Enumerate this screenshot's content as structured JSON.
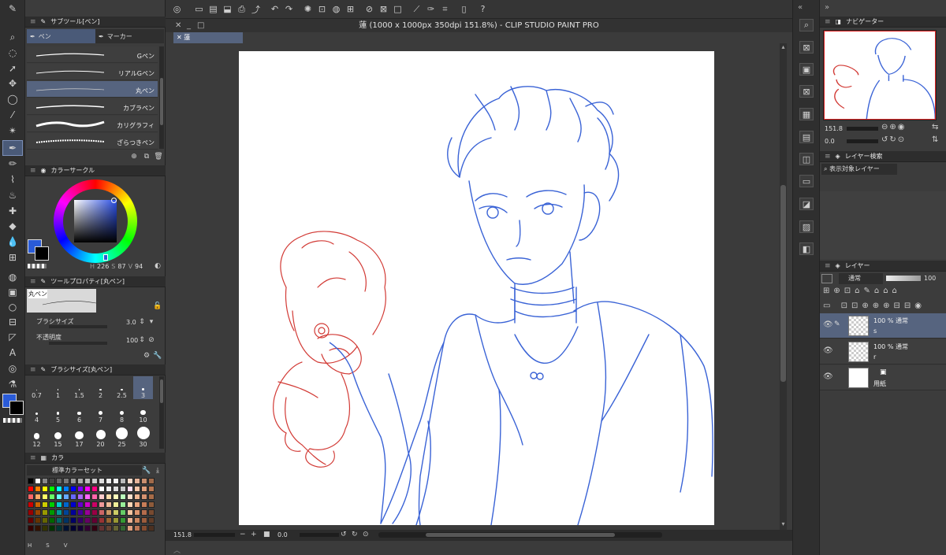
{
  "window": {
    "title": "蓮 (1000 x 1000px 350dpi 151.8%)  - CLIP STUDIO PAINT PRO",
    "doc_tab": "蓮"
  },
  "subtool": {
    "header": "サブツール[ペン]",
    "tabs": [
      "ペン",
      "マーカー"
    ],
    "brushes": [
      "Gペン",
      "リアルGペン",
      "丸ペン",
      "カブラペン",
      "カリグラフィ",
      "ざらつきペン"
    ],
    "selected_brush": "丸ペン"
  },
  "color_circle": {
    "header": "カラーサークル",
    "h": "226",
    "s": "87",
    "v": "94",
    "h_label": "H",
    "s_label": "S",
    "v_label": "V",
    "fg_color": "#2a5bd7",
    "bg_color": "#000000"
  },
  "tool_property": {
    "header": "ツールプロパティ[丸ペン]",
    "preview_label": "丸ペン",
    "brush_size_label": "ブラシサイズ",
    "brush_size": "3.0",
    "opacity_label": "不透明度",
    "opacity": "100"
  },
  "brush_size_panel": {
    "header": "ブラシサイズ[丸ペン]",
    "sizes": [
      "0.7",
      "1",
      "1.5",
      "2",
      "2.5",
      "3",
      "4",
      "5",
      "6",
      "7",
      "8",
      "10",
      "12",
      "15",
      "17",
      "20",
      "25",
      "30"
    ],
    "selected": "3"
  },
  "color_set": {
    "tab_label": "カラ",
    "set_name": "標準カラーセット",
    "bottom_labels": [
      "H",
      "S",
      "V"
    ]
  },
  "canvas_status": {
    "zoom": "151.8",
    "rotation": "0.0"
  },
  "navigator": {
    "header": "ナビゲーター",
    "zoom": "151.8",
    "rotation": "0.0"
  },
  "layer_search": {
    "header": "レイヤー検索",
    "dropdown": "表示対象レイヤー"
  },
  "layers": {
    "header": "レイヤー",
    "blend_mode": "通常",
    "opacity": "100",
    "items": [
      {
        "mode": "100 % 通常",
        "name": "s",
        "selected": true
      },
      {
        "mode": "100 % 通常",
        "name": "r",
        "selected": false
      },
      {
        "mode": "",
        "name": "用紙",
        "selected": false
      }
    ]
  },
  "colors": {
    "accent": "#56647f",
    "sketch_blue": "#3a63d6",
    "sketch_red": "#d23a35"
  }
}
